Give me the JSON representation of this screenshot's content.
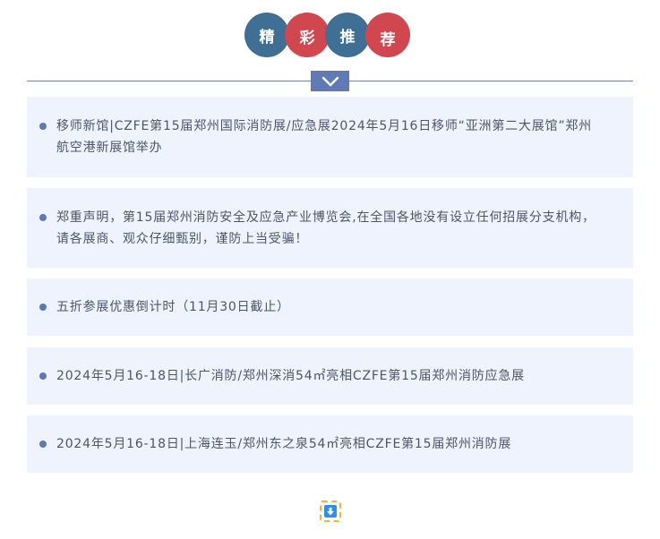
{
  "header": {
    "characters": [
      "精",
      "彩",
      "推",
      "荐"
    ],
    "colors": {
      "blue": "#3f6f95",
      "red": "#d0474f",
      "accent": "#5f7ab5"
    }
  },
  "divider": {
    "icon": "chevron-down-icon"
  },
  "news": [
    {
      "text": "移师新馆|CZFE第15届郑州国际消防展/应急展2024年5月16日移师“亚洲第二大展馆”郑州航空港新展馆举办"
    },
    {
      "text": "郑重声明，第15届郑州消防安全及应急产业博览会,在全国各地没有设立任何招展分支机构，请各展商、观众仔细甄别，谨防上当受骗！"
    },
    {
      "text": "五折参展优惠倒计时（11月30日截止）"
    },
    {
      "text": "2024年5月16-18日|长广消防/郑州深消54㎡亮相CZFE第15届郑州消防应急展"
    },
    {
      "text": "2024年5月16-18日|上海连玉/郑州东之泉54㎡亮相CZFE第15届郑州消防展"
    }
  ],
  "footer": {
    "icon": "down-arrow-icon"
  }
}
